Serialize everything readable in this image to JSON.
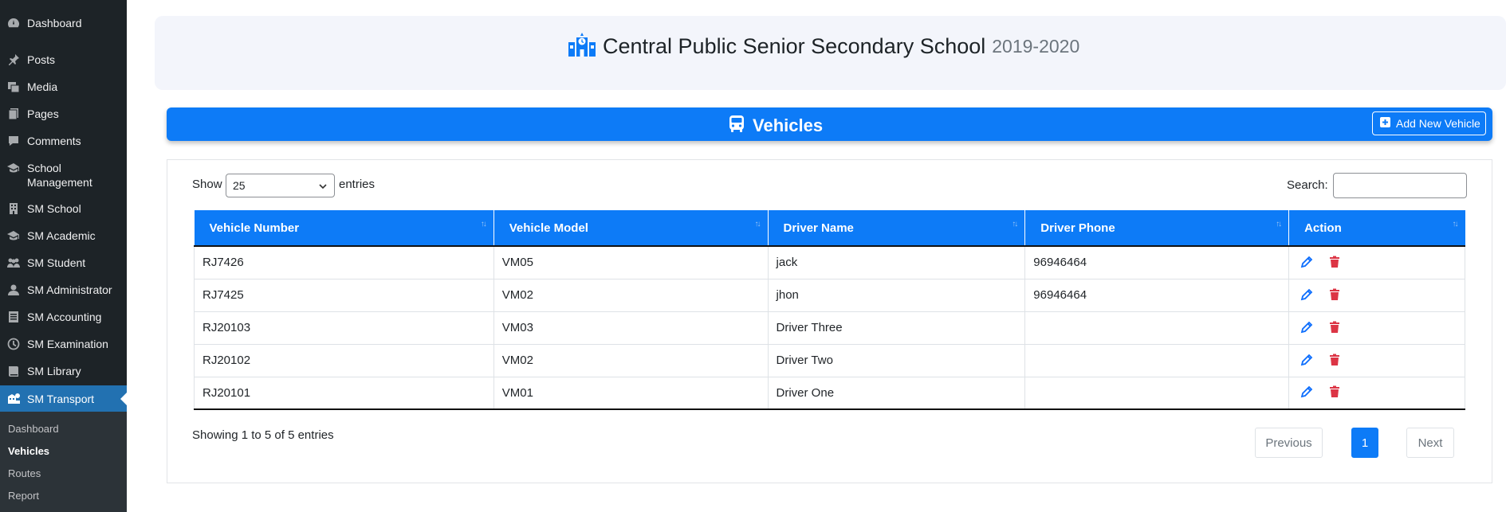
{
  "sidebar": {
    "items": [
      {
        "label": "Dashboard",
        "icon": "dashboard-icon"
      },
      {
        "label": "Posts",
        "icon": "pin-icon"
      },
      {
        "label": "Media",
        "icon": "media-icon"
      },
      {
        "label": "Pages",
        "icon": "pages-icon"
      },
      {
        "label": "Comments",
        "icon": "comment-icon"
      },
      {
        "label": "School Management",
        "icon": "graduation-cap-icon"
      },
      {
        "label": "SM School",
        "icon": "building-icon"
      },
      {
        "label": "SM Academic",
        "icon": "graduation-cap-icon"
      },
      {
        "label": "SM Student",
        "icon": "students-icon"
      },
      {
        "label": "SM Administrator",
        "icon": "user-icon"
      },
      {
        "label": "SM Accounting",
        "icon": "ledger-icon"
      },
      {
        "label": "SM Examination",
        "icon": "clock-icon"
      },
      {
        "label": "SM Library",
        "icon": "book-icon"
      },
      {
        "label": "SM Transport",
        "icon": "transport-icon"
      }
    ],
    "submenu": [
      "Dashboard",
      "Vehicles",
      "Routes",
      "Report"
    ]
  },
  "header": {
    "school_name": "Central Public Senior Secondary School",
    "session": "2019-2020"
  },
  "vehicles_bar": {
    "title": "Vehicles",
    "add_button": "Add New Vehicle"
  },
  "controls": {
    "show_label": "Show",
    "entries_value": "25",
    "entries_label": "entries",
    "search_label": "Search:",
    "search_value": ""
  },
  "table": {
    "columns": [
      "Vehicle Number",
      "Vehicle Model",
      "Driver Name",
      "Driver Phone",
      "Action"
    ],
    "rows": [
      [
        "RJ7426",
        "VM05",
        "jack",
        "96946464"
      ],
      [
        "RJ7425",
        "VM02",
        "jhon",
        "96946464"
      ],
      [
        "RJ20103",
        "VM03",
        "Driver Three",
        ""
      ],
      [
        "RJ20102",
        "VM02",
        "Driver Two",
        ""
      ],
      [
        "RJ20101",
        "VM01",
        "Driver One",
        ""
      ]
    ]
  },
  "footer": {
    "info": "Showing 1 to 5 of 5 entries",
    "previous": "Previous",
    "page": "1",
    "next": "Next"
  },
  "colors": {
    "sidebar": "#1d2327",
    "active": "#2271b1",
    "primary": "#0d7bf7",
    "danger": "#dc3545"
  }
}
